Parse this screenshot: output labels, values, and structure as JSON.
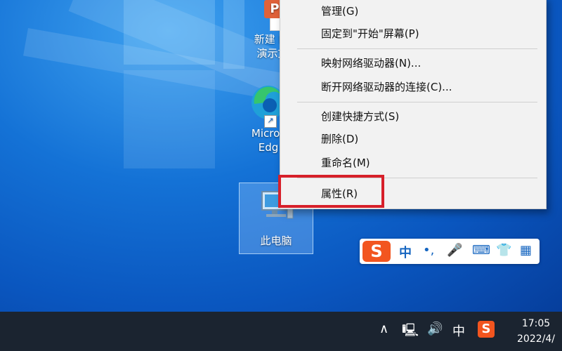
{
  "desktop": {
    "icons": [
      {
        "name": "ppt-icon",
        "label_line1": "新建 Po",
        "label_line2": "演示文"
      },
      {
        "name": "edge-icon",
        "label_line1": "Micros",
        "label_line2": "Edg"
      },
      {
        "name": "this-pc-icon",
        "label_line1": "此电脑"
      }
    ]
  },
  "context_menu": {
    "items": [
      {
        "label": "管理(G)"
      },
      {
        "label": "固定到\"开始\"屏幕(P)"
      },
      {
        "label": "映射网络驱动器(N)..."
      },
      {
        "label": "断开网络驱动器的连接(C)..."
      },
      {
        "label": "创建快捷方式(S)"
      },
      {
        "label": "删除(D)"
      },
      {
        "label": "重命名(M)"
      },
      {
        "label": "属性(R)"
      }
    ]
  },
  "ime_bar": {
    "logo": "S",
    "mode": "中",
    "punct": "•,",
    "mic": "🎤",
    "keyboard": "⌨",
    "skin": "👕",
    "tools": "▦"
  },
  "taskbar": {
    "tray": {
      "chevron": "∧",
      "network": "🖳",
      "volume": "🔊",
      "ime_mode": "中",
      "ime_logo": "S"
    },
    "time": "17:05",
    "date": "2022/4/"
  },
  "colors": {
    "highlight": "#d7202a",
    "ime_accent": "#f2551f",
    "desktop_blue": "#1472d6"
  }
}
